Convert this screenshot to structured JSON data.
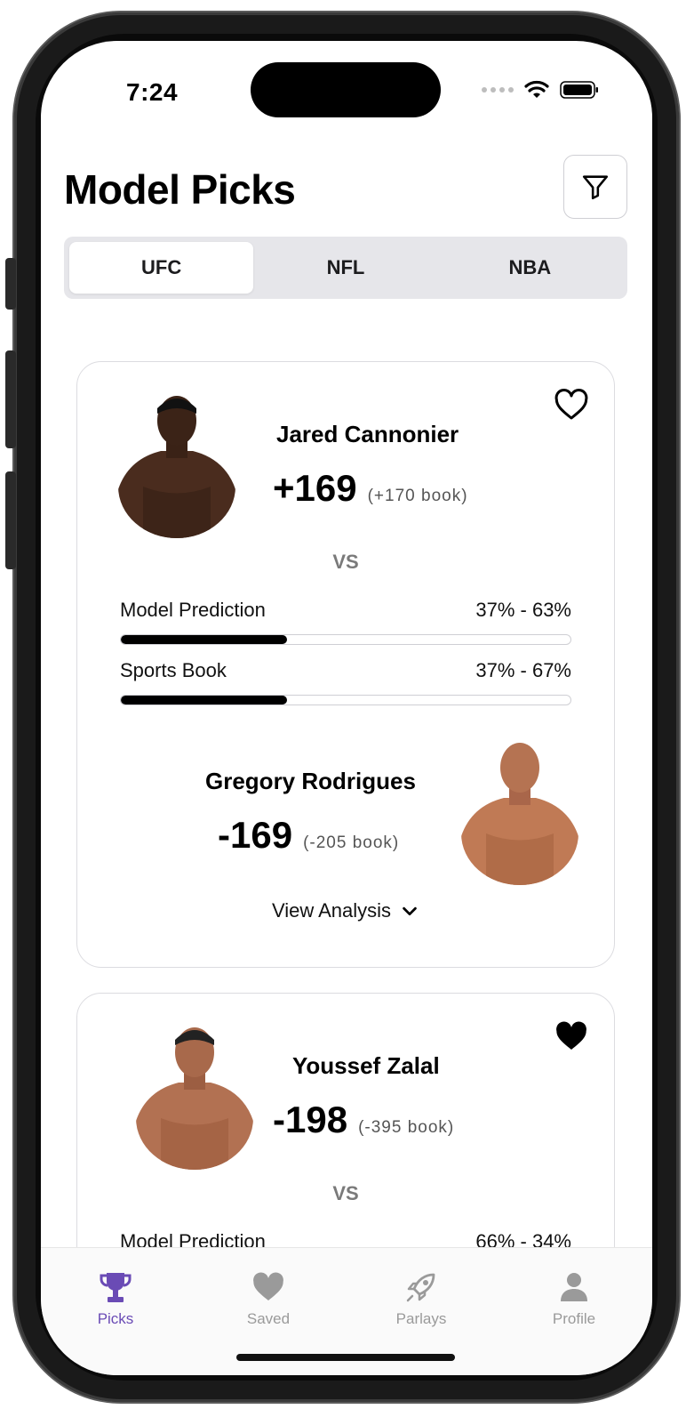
{
  "status_bar": {
    "time": "7:24"
  },
  "header": {
    "title": "Model Picks"
  },
  "tabs": [
    {
      "label": "UFC",
      "active": true
    },
    {
      "label": "NFL",
      "active": false
    },
    {
      "label": "NBA",
      "active": false
    }
  ],
  "cards": [
    {
      "favorited": false,
      "fighter_a": {
        "name": "Jared Cannonier",
        "odds": "+169",
        "book": "(+170 book)"
      },
      "vs": "VS",
      "model_prediction": {
        "label": "Model Prediction",
        "value": "37% - 63%",
        "fill_pct": 37
      },
      "sports_book": {
        "label": "Sports Book",
        "value": "37% - 67%",
        "fill_pct": 37
      },
      "fighter_b": {
        "name": "Gregory Rodrigues",
        "odds": "-169",
        "book": "(-205 book)"
      },
      "analysis_label": "View Analysis"
    },
    {
      "favorited": true,
      "fighter_a": {
        "name": "Youssef Zalal",
        "odds": "-198",
        "book": "(-395 book)"
      },
      "vs": "VS",
      "model_prediction": {
        "label": "Model Prediction",
        "value": "66% - 34%"
      }
    }
  ],
  "bottom_nav": [
    {
      "label": "Picks",
      "icon": "trophy-icon",
      "active": true
    },
    {
      "label": "Saved",
      "icon": "heart-icon",
      "active": false
    },
    {
      "label": "Parlays",
      "icon": "rocket-icon",
      "active": false
    },
    {
      "label": "Profile",
      "icon": "person-icon",
      "active": false
    }
  ],
  "colors": {
    "accent": "#6a4bb5",
    "inactive": "#9a9a9a",
    "bar_fill": "#000000"
  }
}
